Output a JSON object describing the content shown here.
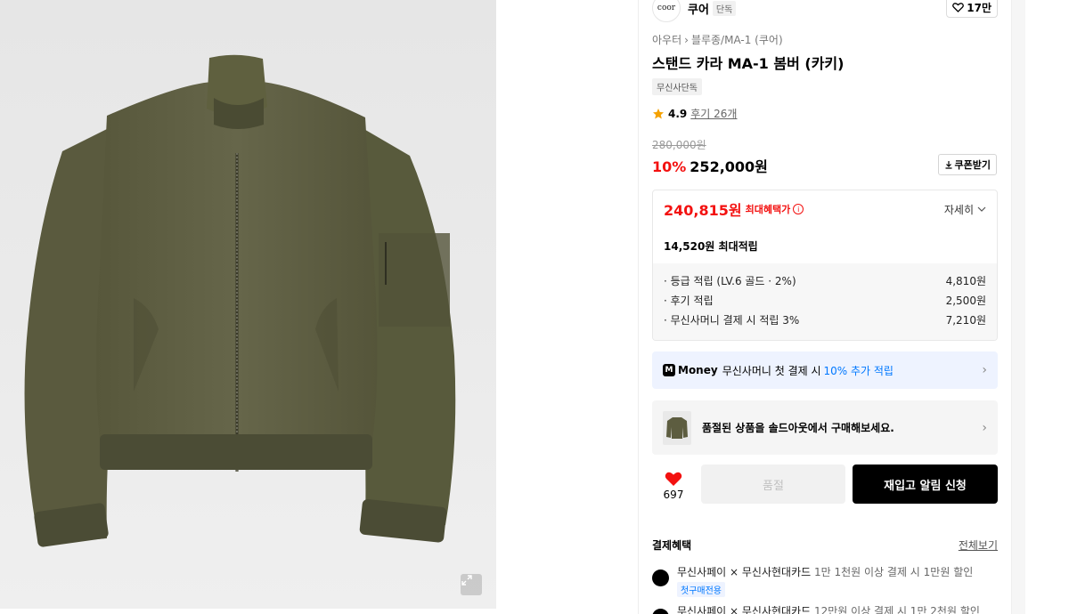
{
  "brand": {
    "logo_text": "coor",
    "name": "쿠어",
    "tag": "단독",
    "like_count": "17만"
  },
  "breadcrumb": {
    "level1": "아우터",
    "sep": "›",
    "level2": "블루종/MA-1 (쿠어)"
  },
  "product": {
    "title": "스탠드 카라 MA-1 봄버 (카키)",
    "exclusive_badge": "무신사단독"
  },
  "rating": {
    "score": "4.9",
    "reviews": "후기 26개"
  },
  "price": {
    "original": "280,000원",
    "discount": "10%",
    "sale": "252,000원",
    "coupon_label": "쿠폰받기"
  },
  "benefit": {
    "max_price": "240,815원",
    "max_label": "최대혜택가",
    "detail_label": "자세히",
    "points_summary": "14,520원 최대적립",
    "points": [
      {
        "label": "· 등급 적립 (LV.6 골드 · 2%)",
        "value": "4,810원"
      },
      {
        "label": "· 후기 적립",
        "value": "2,500원"
      },
      {
        "label": "· 무신사머니 결제 시 적립 3%",
        "value": "7,210원"
      }
    ]
  },
  "money_banner": {
    "icon": "M",
    "brand": "Money",
    "text": "무신사머니 첫 결제 시",
    "highlight": "10% 추가 적립"
  },
  "soldout_banner": {
    "text": "품절된 상품을 솔드아웃에서 구매해보세요."
  },
  "actions": {
    "likes": "697",
    "soldout_label": "품절",
    "restock_label": "재입고 알림 신청"
  },
  "payment": {
    "title": "결제혜택",
    "view_all": "전체보기",
    "items": [
      {
        "name": "무신사페이 × 무신사현대카드",
        "desc": "1만 1천원 이상 결제 시 1만원 할인",
        "badge": "첫구매전용"
      },
      {
        "name": "무신사페이 × 무신사현대카드",
        "desc": "12만원 이상 결제 시 1만 2천원 할인"
      }
    ]
  },
  "colors": {
    "accent_red": "#f31110",
    "accent_blue": "#0078ff",
    "jacket_khaki": "#5d5d40"
  }
}
